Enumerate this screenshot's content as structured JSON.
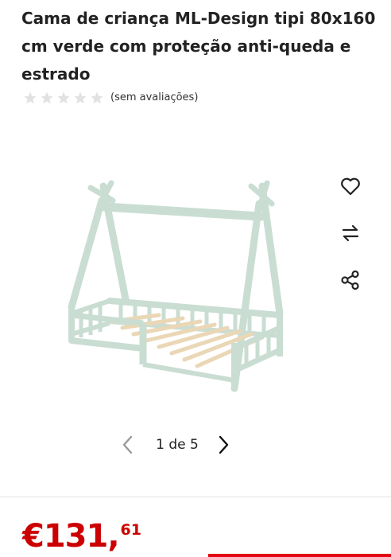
{
  "product": {
    "title": "Cama de criança ML-Design tipi 80x160 cm verde com proteção anti-queda e estrado"
  },
  "rating": {
    "stars_filled": 0,
    "stars_total": 5,
    "reviews_label": "(sem avaliações)"
  },
  "gallery": {
    "counter": "1 de 5",
    "current": 1,
    "total": 5
  },
  "actions": {
    "favorite_icon": "heart-icon",
    "compare_icon": "compare-arrows-icon",
    "share_icon": "share-icon"
  },
  "price": {
    "main": "€131,",
    "cents": "61"
  },
  "colors": {
    "price": "#cc0000",
    "accent": "#e30613",
    "star_empty": "#e2e2e2"
  }
}
